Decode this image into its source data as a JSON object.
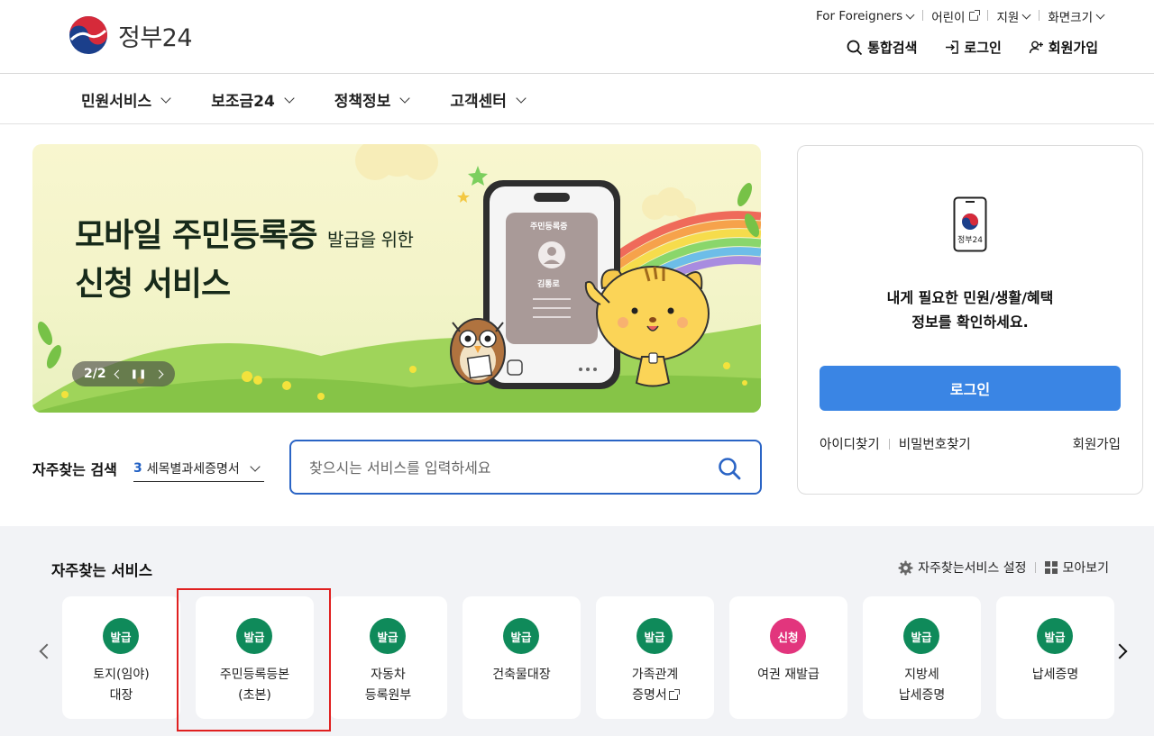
{
  "header": {
    "logo_text": "정부24",
    "utility": [
      {
        "label": "For Foreigners",
        "icon": "chevron-down-icon"
      },
      {
        "label": "어린이",
        "icon": "external-link-icon"
      },
      {
        "label": "지원",
        "icon": "chevron-down-icon"
      },
      {
        "label": "화면크기",
        "icon": "chevron-down-icon"
      }
    ],
    "account": {
      "search": "통합검색",
      "login": "로그인",
      "signup": "회원가입"
    }
  },
  "nav": {
    "items": [
      "민원서비스",
      "보조금24",
      "정책정보",
      "고객센터"
    ]
  },
  "banner": {
    "title_bold": "모바일 주민등록증",
    "title_small": "발급을 위한",
    "title_line2": "신청 서비스",
    "pager": "2/2",
    "card_title": "주민등록증",
    "card_name": "김통로"
  },
  "search": {
    "freq_label": "자주찾는 검색",
    "freq_rank": "3",
    "freq_term": "세목별과세증명서",
    "placeholder": "찾으시는 서비스를 입력하세요"
  },
  "login_card": {
    "phone_label": "정부24",
    "message_line1": "내게 필요한 민원/생활/혜택",
    "message_line2": "정보를 확인하세요.",
    "login_button": "로그인",
    "find_id": "아이디찾기",
    "find_pw": "비밀번호찾기",
    "signup": "회원가입"
  },
  "favorites": {
    "title": "자주찾는 서비스",
    "settings": "자주찾는서비스 설정",
    "view_all": "모아보기",
    "items": [
      {
        "badge": "발급",
        "line1": "토지(임야)",
        "line2": "대장",
        "color": "#0f8a5a"
      },
      {
        "badge": "발급",
        "line1": "주민등록등본",
        "line2": "(초본)",
        "color": "#0f8a5a"
      },
      {
        "badge": "발급",
        "line1": "자동차",
        "line2": "등록원부",
        "color": "#0f8a5a"
      },
      {
        "badge": "발급",
        "line1": "건축물대장",
        "line2": "",
        "color": "#0f8a5a"
      },
      {
        "badge": "발급",
        "line1": "가족관계",
        "line2": "증명서",
        "color": "#0f8a5a"
      },
      {
        "badge": "신청",
        "line1": "여권 재발급",
        "line2": "",
        "color": "#e2357d"
      },
      {
        "badge": "발급",
        "line1": "지방세",
        "line2": "납세증명",
        "color": "#0f8a5a"
      },
      {
        "badge": "발급",
        "line1": "납세증명",
        "line2": "",
        "color": "#0f8a5a"
      }
    ]
  },
  "colors": {
    "primary_blue": "#3a85e4",
    "search_border": "#2a64c5",
    "issue_green": "#0f8a5a",
    "apply_pink": "#e2357d",
    "highlight_red": "#e02020"
  }
}
